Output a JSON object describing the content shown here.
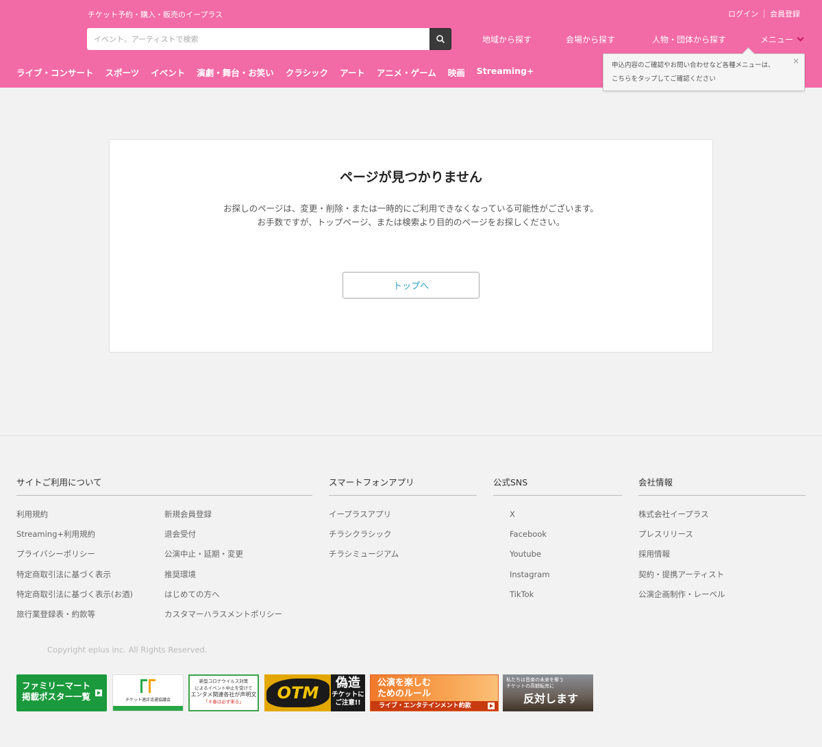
{
  "header": {
    "tagline": "チケット予約・購入・販売のイープラス",
    "login": "ログイン",
    "register": "会員登録",
    "search_placeholder": "イベント、アーティストで検索",
    "nav": {
      "region": "地域から探す",
      "venue": "会場から探す",
      "people": "人物・団体から探す",
      "menu": "メニュー"
    },
    "categories": [
      "ライブ・コンサート",
      "スポーツ",
      "イベント",
      "演劇・舞台・お笑い",
      "クラシック",
      "アート",
      "アニメ・ゲーム",
      "映画",
      "Streaming+"
    ]
  },
  "tooltip": {
    "line1": "申込内容のご確認やお問い合わせなど各種メニューは、",
    "line2": "こちらをタップしてご確認ください",
    "close": "×"
  },
  "main": {
    "title": "ページが見つかりません",
    "message_line1": "お探しのページは、変更・削除・または一時的にご利用できなくなっている可能性がございます。",
    "message_line2": "お手数ですが、トップページ、または検索より目的のページをお探しください。",
    "top_button": "トップへ"
  },
  "footer": {
    "site_usage": {
      "heading": "サイトご利用について",
      "col1": [
        "利用規約",
        "Streaming+利用規約",
        "プライバシーポリシー",
        "特定商取引法に基づく表示",
        "特定商取引法に基づく表示(お酒)",
        "旅行業登録表・約款等"
      ],
      "col2": [
        "新規会員登録",
        "退会受付",
        "公演中止・延期・変更",
        "推奨環境",
        "はじめての方へ",
        "カスタマーハラスメントポリシー"
      ]
    },
    "apps": {
      "heading": "スマートフォンアプリ",
      "items": [
        "イープラスアプリ",
        "チラシクラシック",
        "チラシミュージアム"
      ]
    },
    "sns": {
      "heading": "公式SNS",
      "items": [
        "X",
        "Facebook",
        "Youtube",
        "Instagram",
        "TikTok"
      ]
    },
    "company": {
      "heading": "会社情報",
      "items": [
        "株式会社イープラス",
        "プレスリリース",
        "採用情報",
        "契約・提携アーティスト",
        "公演企画制作・レーベル"
      ]
    },
    "copyright": "Copyright eplus inc. All Rights Reserved."
  },
  "banners": {
    "familymart_line1": "ファミリーマート",
    "familymart_line2": "掲載ポスター一覧",
    "fair_ticket": "チケット適正流通協議会",
    "covid_line1": "新型コロナウイルス対策",
    "covid_line2": "によるイベント中止を受けて",
    "covid_line3": "エンタメ関連各社が声明文",
    "covid_line4": "「＃春は必ず来る」",
    "otm_logo": "OTM",
    "otm_big": "偽造",
    "otm_small1": "チケットに",
    "otm_small2": "ご注意!!",
    "rules_line1": "公演を楽しむ",
    "rules_line2": "ためのルール",
    "rules_line3": "ライブ・エンタテインメント約款",
    "resale_line1": "私たちは音楽の未来を奪う",
    "resale_line2": "チケットの高額転売に",
    "resale_big": "反対します"
  },
  "colors": {
    "header_bg": "#f26aa6",
    "link_blue": "#2a9fc7",
    "menu_chevron": "#c2185b"
  }
}
